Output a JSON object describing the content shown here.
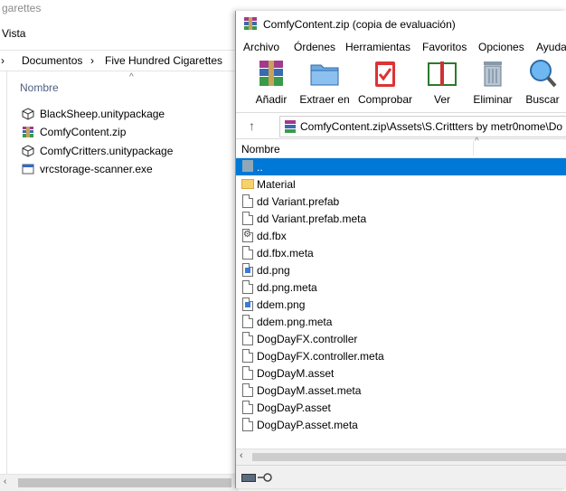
{
  "explorer": {
    "title": "garettes",
    "menu_vista": "Vista",
    "breadcrumb": [
      "Documentos",
      "Five Hundred Cigarettes"
    ],
    "column_name": "Nombre",
    "files": [
      {
        "name": "BlackSheep.unitypackage",
        "icon": "unitypackage-icon"
      },
      {
        "name": "ComfyContent.zip",
        "icon": "winrar-archive-icon"
      },
      {
        "name": "ComfyCritters.unitypackage",
        "icon": "unitypackage-icon"
      },
      {
        "name": "vrcstorage-scanner.exe",
        "icon": "exe-icon"
      }
    ]
  },
  "winrar": {
    "title": "ComfyContent.zip (copia de evaluación)",
    "menu": [
      "Archivo",
      "Órdenes",
      "Herramientas",
      "Favoritos",
      "Opciones",
      "Ayuda"
    ],
    "toolbar": [
      "Añadir",
      "Extraer en",
      "Comprobar",
      "Ver",
      "Eliminar",
      "Buscar"
    ],
    "path": "ComfyContent.zip\\Assets\\S.Crittters by metr0nome\\Do",
    "column_name": "Nombre",
    "files": [
      {
        "name": "..",
        "type": "updir"
      },
      {
        "name": "Material",
        "type": "folder"
      },
      {
        "name": "dd Variant.prefab",
        "type": "doc"
      },
      {
        "name": "dd Variant.prefab.meta",
        "type": "doc"
      },
      {
        "name": "dd.fbx",
        "type": "fbx"
      },
      {
        "name": "dd.fbx.meta",
        "type": "doc"
      },
      {
        "name": "dd.png",
        "type": "png"
      },
      {
        "name": "dd.png.meta",
        "type": "doc"
      },
      {
        "name": "ddem.png",
        "type": "png"
      },
      {
        "name": "ddem.png.meta",
        "type": "doc"
      },
      {
        "name": "DogDayFX.controller",
        "type": "doc"
      },
      {
        "name": "DogDayFX.controller.meta",
        "type": "doc"
      },
      {
        "name": "DogDayM.asset",
        "type": "doc"
      },
      {
        "name": "DogDayM.asset.meta",
        "type": "doc"
      },
      {
        "name": "DogDayP.asset",
        "type": "doc"
      },
      {
        "name": "DogDayP.asset.meta",
        "type": "doc"
      }
    ],
    "selected_index": 0,
    "colors": {
      "selection": "#0078d7"
    }
  }
}
